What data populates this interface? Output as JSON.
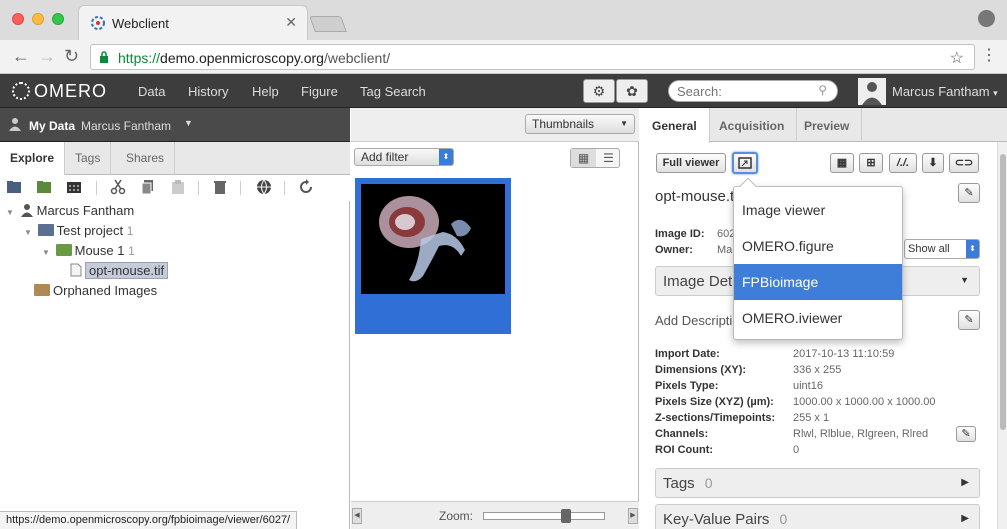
{
  "browser": {
    "tab_title": "Webclient",
    "tab_close": "✕",
    "url_secure": "https://",
    "url_host": "demo.openmicroscopy.org",
    "url_path": "/webclient/",
    "status_url": "https://demo.openmicroscopy.org/fpbioimage/viewer/6027/"
  },
  "header": {
    "logo": "OMERO",
    "nav": [
      "Data",
      "History",
      "Help",
      "Figure",
      "Tag Search"
    ],
    "search_placeholder": "Search:",
    "user": "Marcus Fantham"
  },
  "left": {
    "mydata_label": "My Data",
    "mydata_user": "Marcus Fantham",
    "tabs": [
      "Explore",
      "Tags",
      "Shares"
    ],
    "tree": {
      "root": "Marcus Fantham",
      "project": "Test project",
      "project_count": "1",
      "dataset": "Mouse 1",
      "dataset_count": "1",
      "image": "opt-mouse.tif",
      "orphaned": "Orphaned Images"
    }
  },
  "center": {
    "view_select": "Thumbnails",
    "add_filter": "Add filter",
    "zoom_label": "Zoom:",
    "zoom_level": 0.7
  },
  "right": {
    "tabs": [
      "General",
      "Acquisition",
      "Preview"
    ],
    "full_viewer": "Full viewer",
    "image_name": "opt-mouse.t",
    "image_id_label": "Image ID:",
    "image_id_value": "602",
    "owner_label": "Owner:",
    "owner_value": "Ma",
    "show_all": "Show all",
    "image_details": "Image Det",
    "add_description": "Add Descripti",
    "info": [
      {
        "k": "Import Date:",
        "v": "2017-10-13 11:10:59"
      },
      {
        "k": "Dimensions (XY):",
        "v": "336 x 255"
      },
      {
        "k": "Pixels Type:",
        "v": "uint16"
      },
      {
        "k": "Pixels Size (XYZ) (µm):",
        "v": "1000.00 x 1000.00 x 1000.00"
      },
      {
        "k": "Z-sections/Timepoints:",
        "v": "255 x 1"
      },
      {
        "k": "Channels:",
        "v": "Rlwl, Rlblue, Rlgreen, Rlred"
      },
      {
        "k": "ROI Count:",
        "v": "0"
      }
    ],
    "tags_label": "Tags",
    "tags_count": "0",
    "kvp_label": "Key-Value Pairs",
    "kvp_count": "0"
  },
  "popup": {
    "items": [
      "Image viewer",
      "OMERO.figure",
      "FPBioimage",
      "OMERO.iviewer"
    ],
    "highlighted": "FPBioimage"
  },
  "colors": {
    "accent": "#3f7ed8",
    "header_bg": "#3d3d3d",
    "selection_tile": "#2f6fd6"
  }
}
